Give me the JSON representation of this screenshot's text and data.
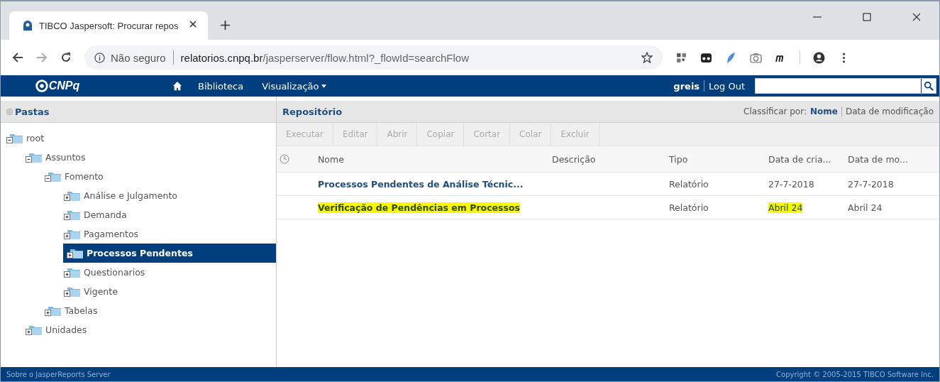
{
  "browser": {
    "tab": {
      "title": "TIBCO Jaspersoft: Procurar repos"
    },
    "address": {
      "security": "Não seguro",
      "domain": "relatorios.cnpq.br",
      "path": "/jasperserver/flow.html?_flowId=searchFlow"
    }
  },
  "app_bar": {
    "logo": "CNPq",
    "menu": [
      {
        "label": "Biblioteca",
        "dropdown": false
      },
      {
        "label": "Visualização",
        "dropdown": true
      }
    ],
    "user": "greis",
    "logout": "Log Out"
  },
  "folders": {
    "title": "Pastas",
    "tree": [
      {
        "label": "root",
        "expanded": true,
        "selected": false,
        "children": [
          {
            "label": "Assuntos",
            "expanded": true,
            "selected": false,
            "children": [
              {
                "label": "Fomento",
                "expanded": true,
                "selected": false,
                "children": [
                  {
                    "label": "Análise e Julgamento",
                    "expanded": false,
                    "selected": false
                  },
                  {
                    "label": "Demanda",
                    "expanded": false,
                    "selected": false
                  },
                  {
                    "label": "Pagamentos",
                    "expanded": false,
                    "selected": false
                  },
                  {
                    "label": "Processos Pendentes",
                    "expanded": false,
                    "selected": true
                  },
                  {
                    "label": "Questionarios",
                    "expanded": false,
                    "selected": false
                  },
                  {
                    "label": "Vigente",
                    "expanded": false,
                    "selected": false
                  }
                ]
              },
              {
                "label": "Tabelas",
                "expanded": false,
                "selected": false
              }
            ]
          },
          {
            "label": "Unidades",
            "expanded": false,
            "selected": false
          }
        ]
      }
    ]
  },
  "repository": {
    "title": "Repositório",
    "sort_label": "Classificar por:",
    "sort_options": [
      {
        "label": "Nome",
        "selected": true
      },
      {
        "label": "Data de modificação",
        "selected": false
      }
    ],
    "toolbar": [
      {
        "label": "Executar",
        "disabled": true
      },
      {
        "label": "Editar",
        "disabled": true
      },
      {
        "label": "Abrir",
        "disabled": true
      },
      {
        "label": "Copiar",
        "disabled": true
      },
      {
        "label": "Cortar",
        "disabled": true
      },
      {
        "label": "Colar",
        "disabled": true
      },
      {
        "label": "Excluir",
        "disabled": true
      }
    ],
    "columns": [
      "Nome",
      "Descrição",
      "Tipo",
      "Data de cria...",
      "Data de mo..."
    ],
    "rows": [
      {
        "name": "Processos Pendentes de Análise Técnic...",
        "type": "Relatório",
        "created": "27-7-2018",
        "modified": "27-7-2018",
        "highlighted": false
      },
      {
        "name": "Verificação de Pendências em Processos",
        "type": "Relatório",
        "created": "Abril 24",
        "modified": "Abril 24",
        "highlighted": true
      }
    ]
  },
  "footer": {
    "about": "Sobre o JasperReports Server",
    "copyright": "Copyright © 2005-2015 TIBCO Software Inc."
  }
}
